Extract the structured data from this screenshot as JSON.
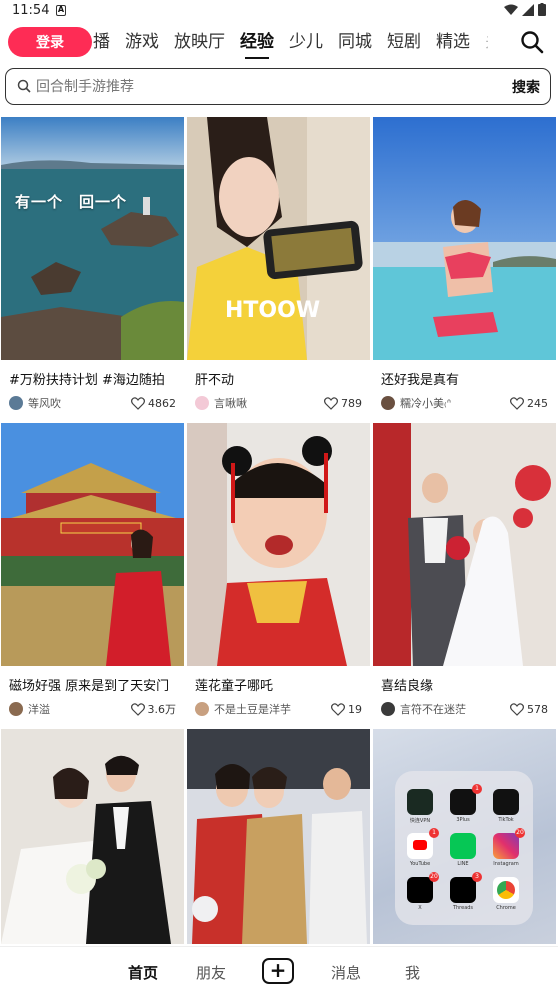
{
  "status": {
    "time": "11:54"
  },
  "topnav": {
    "login_label": "登录",
    "tabs": [
      "播",
      "游戏",
      "放映厅",
      "经验",
      "少儿",
      "同城",
      "短剧",
      "精选",
      "关"
    ],
    "active_tab": "经验"
  },
  "search": {
    "placeholder": "回合制手游推荐",
    "button_label": "搜索"
  },
  "feed": {
    "cards": [
      {
        "caption": "#万粉扶持计划 #海边随拍",
        "author": "等风吹",
        "likes": "4862",
        "overlay": "有一个　回一个"
      },
      {
        "caption": "肝不动",
        "author": "言啾啾",
        "likes": "789"
      },
      {
        "caption": "还好我是真有",
        "author": "糯冷小美₍ᐢ",
        "likes": "245"
      },
      {
        "caption": "磁场好强 原来是到了天安门",
        "author": "洋溢",
        "likes": "3.6万"
      },
      {
        "caption": "莲花童子哪吒",
        "author": "不是土豆是洋芋",
        "likes": "19"
      },
      {
        "caption": "喜结良缘",
        "author": "言符不在迷茫",
        "likes": "578"
      },
      {
        "caption": "",
        "author": "",
        "likes": ""
      },
      {
        "caption": "",
        "author": "",
        "likes": ""
      },
      {
        "caption": "",
        "author": "",
        "likes": ""
      }
    ],
    "folder_apps": [
      "快连VPN",
      "3Plus",
      "TikTok",
      "YouTube",
      "LINE",
      "Instagram",
      "X",
      "Threads",
      "Chrome"
    ],
    "folder_badges": [
      "1",
      "1",
      "20",
      "20",
      "3"
    ]
  },
  "bottomnav": {
    "home": "首页",
    "friends": "朋友",
    "messages": "消息",
    "me": "我"
  },
  "colors": {
    "accent": "#fe2c55"
  }
}
